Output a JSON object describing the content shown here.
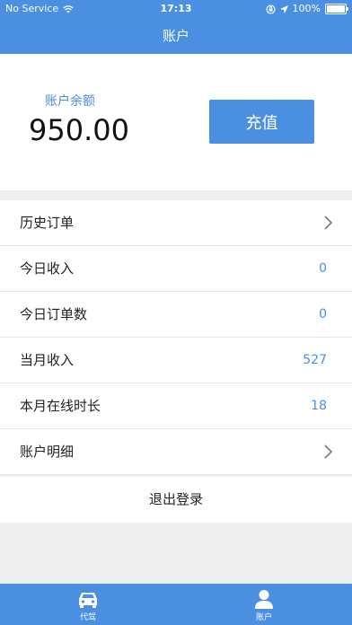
{
  "status_bar": {
    "carrier": "No Service",
    "time": "17:13",
    "battery": "100%"
  },
  "nav": {
    "title": "账户"
  },
  "balance": {
    "label": "账户余额",
    "value": "950.00",
    "recharge_label": "充值"
  },
  "menu": [
    {
      "label": "历史订单",
      "value": "",
      "chevron": true
    },
    {
      "label": "今日收入",
      "value": "0",
      "chevron": false
    },
    {
      "label": "今日订单数",
      "value": "0",
      "chevron": false
    },
    {
      "label": "当月收入",
      "value": "527",
      "chevron": false
    },
    {
      "label": "本月在线时长",
      "value": "18",
      "chevron": false
    },
    {
      "label": "账户明细",
      "value": "",
      "chevron": true
    }
  ],
  "logout_label": "退出登录",
  "tabs": [
    {
      "label": "代驾",
      "icon": "car-icon"
    },
    {
      "label": "账户",
      "icon": "user-icon"
    }
  ],
  "colors": {
    "accent": "#4a8fe0",
    "background": "#efefef"
  }
}
